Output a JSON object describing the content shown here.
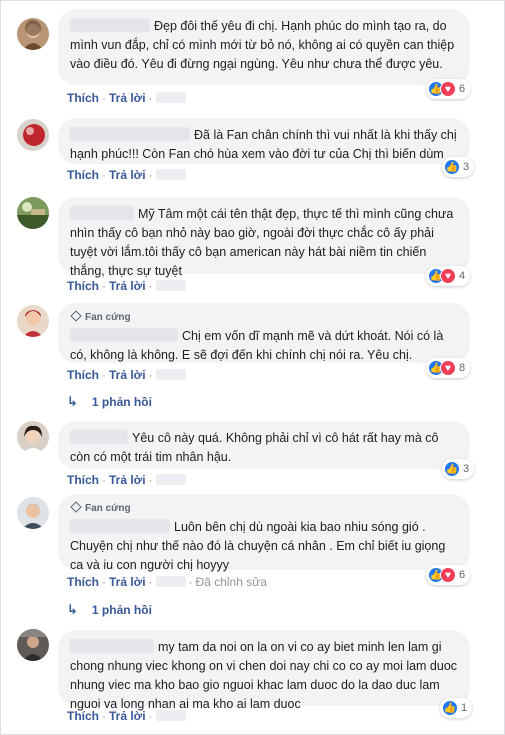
{
  "actions": {
    "like": "Thích",
    "reply": "Trả lời",
    "sep": "·",
    "edited": "Đã chỉnh sửa"
  },
  "badge": "Fan cứng",
  "reply_link": "1 phản hồi",
  "colors": {
    "link": "#385898",
    "bubble": "#f2f3f5",
    "like": "#2078f4",
    "love": "#f33e58"
  },
  "comments": [
    {
      "text": "Đẹp đôi thế yêu đi chị. Hạnh phúc do mình tạo ra, do mình vun đắp, chỉ có mình mới từ bỏ nó, không ai có quyền can thiệp vào điều đó. Yêu đi đừng ngại ngùng. Yêu như chưa thể được yêu.",
      "reactions": "6",
      "reaction_icons": [
        "like-icon",
        "love-icon"
      ]
    },
    {
      "text": "Đã là Fan chân chính thì vui nhất là khi thấy chị hạnh phúc!!! Còn Fan chó hùa xem vào đời tư của Chị thì biến dùm",
      "reactions": "3",
      "reaction_icons": [
        "like-icon"
      ]
    },
    {
      "text": "Mỹ Tâm một cái tên thật đẹp, thực tế thì mình cũng chưa nhìn thấy cô bạn nhỏ này bao giờ, ngoài đời thực chắc cô ấy phải tuyệt vời lắm.tôi thấy cô bạn american này hát bài niềm tin chiến thắng, thực sự tuyệt",
      "reactions": "4",
      "reaction_icons": [
        "like-icon",
        "love-icon"
      ]
    },
    {
      "text": "Chị em vốn dĩ mạnh mẽ và dứt khoát. Nói có là có, không là không. E sẽ đợi đến khi chính chị nói ra. Yêu chị.",
      "reactions": "8",
      "reaction_icons": [
        "like-icon",
        "love-icon"
      ]
    },
    {
      "text": "Yêu cô này quá. Không phải chỉ vì cô hát rất hay mà cô còn có một trái tim nhân hậu.",
      "reactions": "3",
      "reaction_icons": [
        "like-icon"
      ]
    },
    {
      "text": "Luôn bên chị dù ngoài kia bao nhiu sóng gió . Chuyện chị như thế nào đó là chuyện cá nhân . Em chỉ biết iu giọng ca và iu con người chị hoyyy",
      "reactions": "6",
      "reaction_icons": [
        "like-icon",
        "love-icon"
      ]
    },
    {
      "text": "my tam da noi on la on vi co ay biet minh len lam gi chong nhung viec khong on vi chen doi nay chi co co ay moi lam duoc nhung viec ma kho bao gio nguoi khac lam duoc do la dao duc lam nguoi va long nhan ai ma kho ai lam duoc",
      "reactions": "1",
      "reaction_icons": [
        "like-icon"
      ]
    }
  ]
}
